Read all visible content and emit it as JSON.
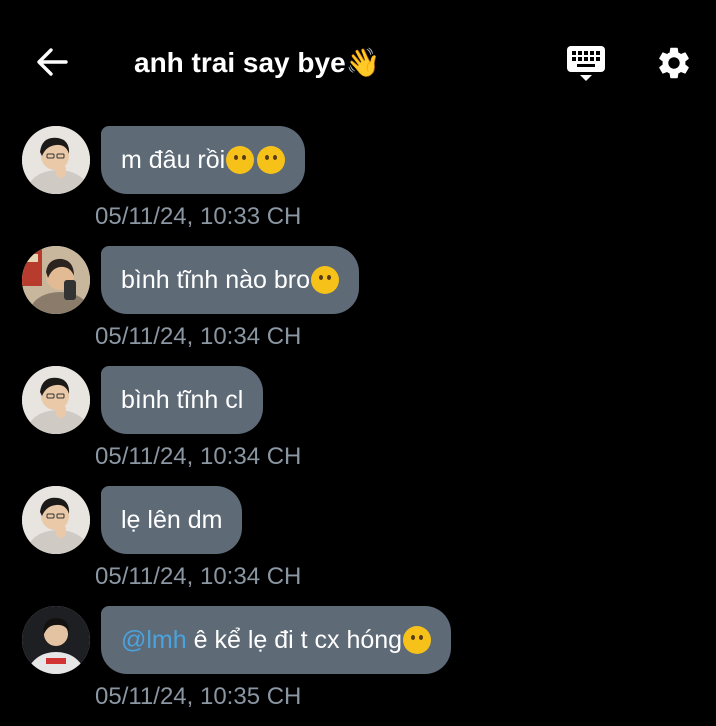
{
  "header": {
    "title": "anh trai say bye👋"
  },
  "messages": [
    {
      "text": "m đâu rồi",
      "emojis": [
        "loudly-crying-face-emoji",
        "face-holding-back-tears-emoji"
      ],
      "time": "05/11/24, 10:33 CH"
    },
    {
      "text": "bình tĩnh nào bro",
      "emojis": [
        "smiling-face-emoji"
      ],
      "time": "05/11/24, 10:34 CH"
    },
    {
      "text": "bình tĩnh cl",
      "emojis": [],
      "time": "05/11/24, 10:34 CH"
    },
    {
      "text": "lẹ lên dm",
      "emojis": [],
      "time": "05/11/24, 10:34 CH"
    },
    {
      "mention": "@lmh",
      "text": " ê kể lẹ đi t cx hóng",
      "emojis": [
        "star-struck-emoji"
      ],
      "time": "05/11/24, 10:35 CH"
    }
  ],
  "colors": {
    "background": "#000000",
    "bubble": "#5e6a76",
    "timestamp": "#8b96a3",
    "mention": "#4aa3df"
  },
  "icons": {
    "back": "back-arrow-icon",
    "keyboard": "keyboard-icon",
    "settings": "gear-icon"
  }
}
